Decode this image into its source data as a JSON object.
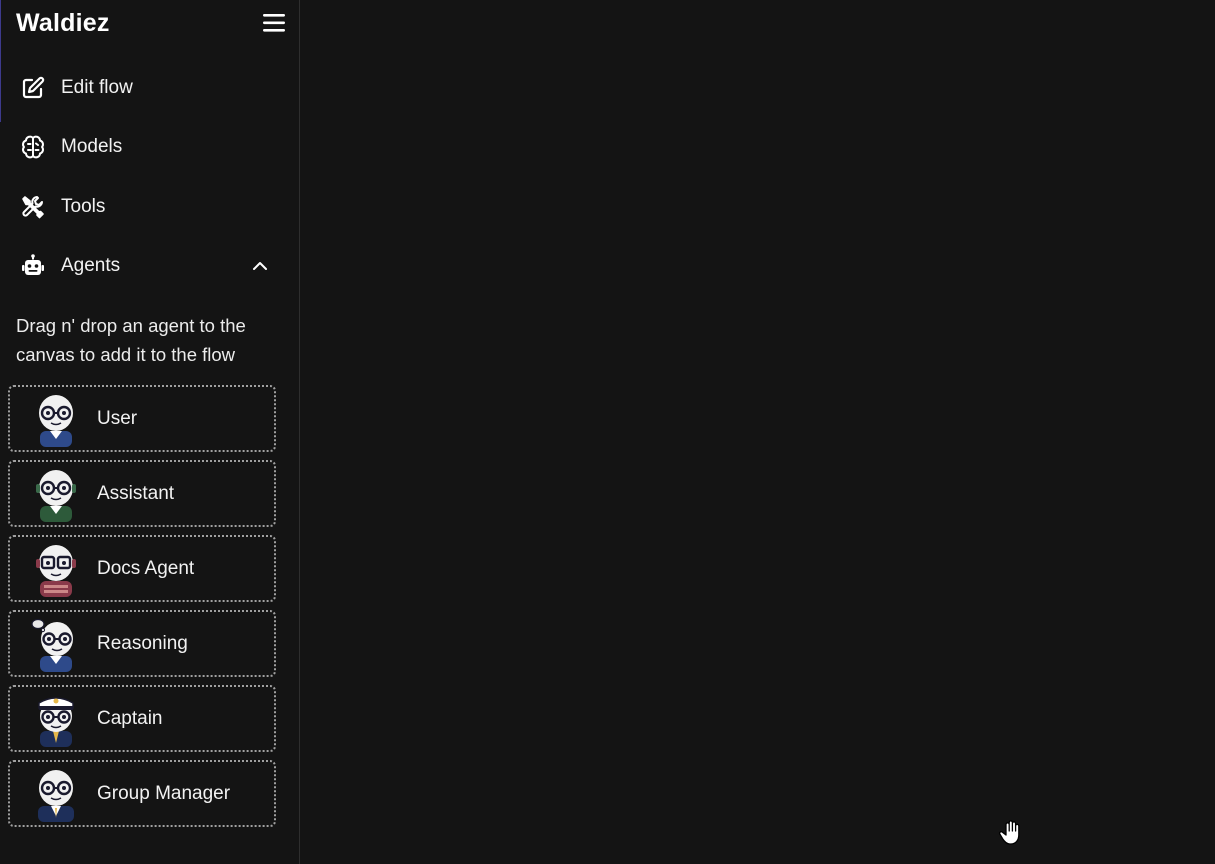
{
  "app": {
    "title": "Waldiez"
  },
  "nav": {
    "items": [
      {
        "label": "Edit flow",
        "icon": "edit-icon"
      },
      {
        "label": "Models",
        "icon": "brain-icon"
      },
      {
        "label": "Tools",
        "icon": "tools-icon"
      },
      {
        "label": "Agents",
        "icon": "robot-icon",
        "expanded": true
      }
    ]
  },
  "agents_panel": {
    "help_text": "Drag n' drop an agent to the canvas to add it to the flow",
    "agents": [
      {
        "label": "User",
        "avatar": "user-agent-avatar",
        "accent": "#2e4a8a"
      },
      {
        "label": "Assistant",
        "avatar": "assistant-agent-avatar",
        "accent": "#2d5a3a"
      },
      {
        "label": "Docs Agent",
        "avatar": "docs-agent-avatar",
        "accent": "#8a3a4a"
      },
      {
        "label": "Reasoning",
        "avatar": "reasoning-agent-avatar",
        "accent": "#2e4a8a"
      },
      {
        "label": "Captain",
        "avatar": "captain-agent-avatar",
        "accent": "#1e2f5a"
      },
      {
        "label": "Group Manager",
        "avatar": "group-manager-agent-avatar",
        "accent": "#1e2f5a"
      }
    ]
  },
  "colors": {
    "background": "#141414",
    "border": "#2e2e2e",
    "text": "#f2f2f2",
    "card_border": "#a0a0a0"
  }
}
